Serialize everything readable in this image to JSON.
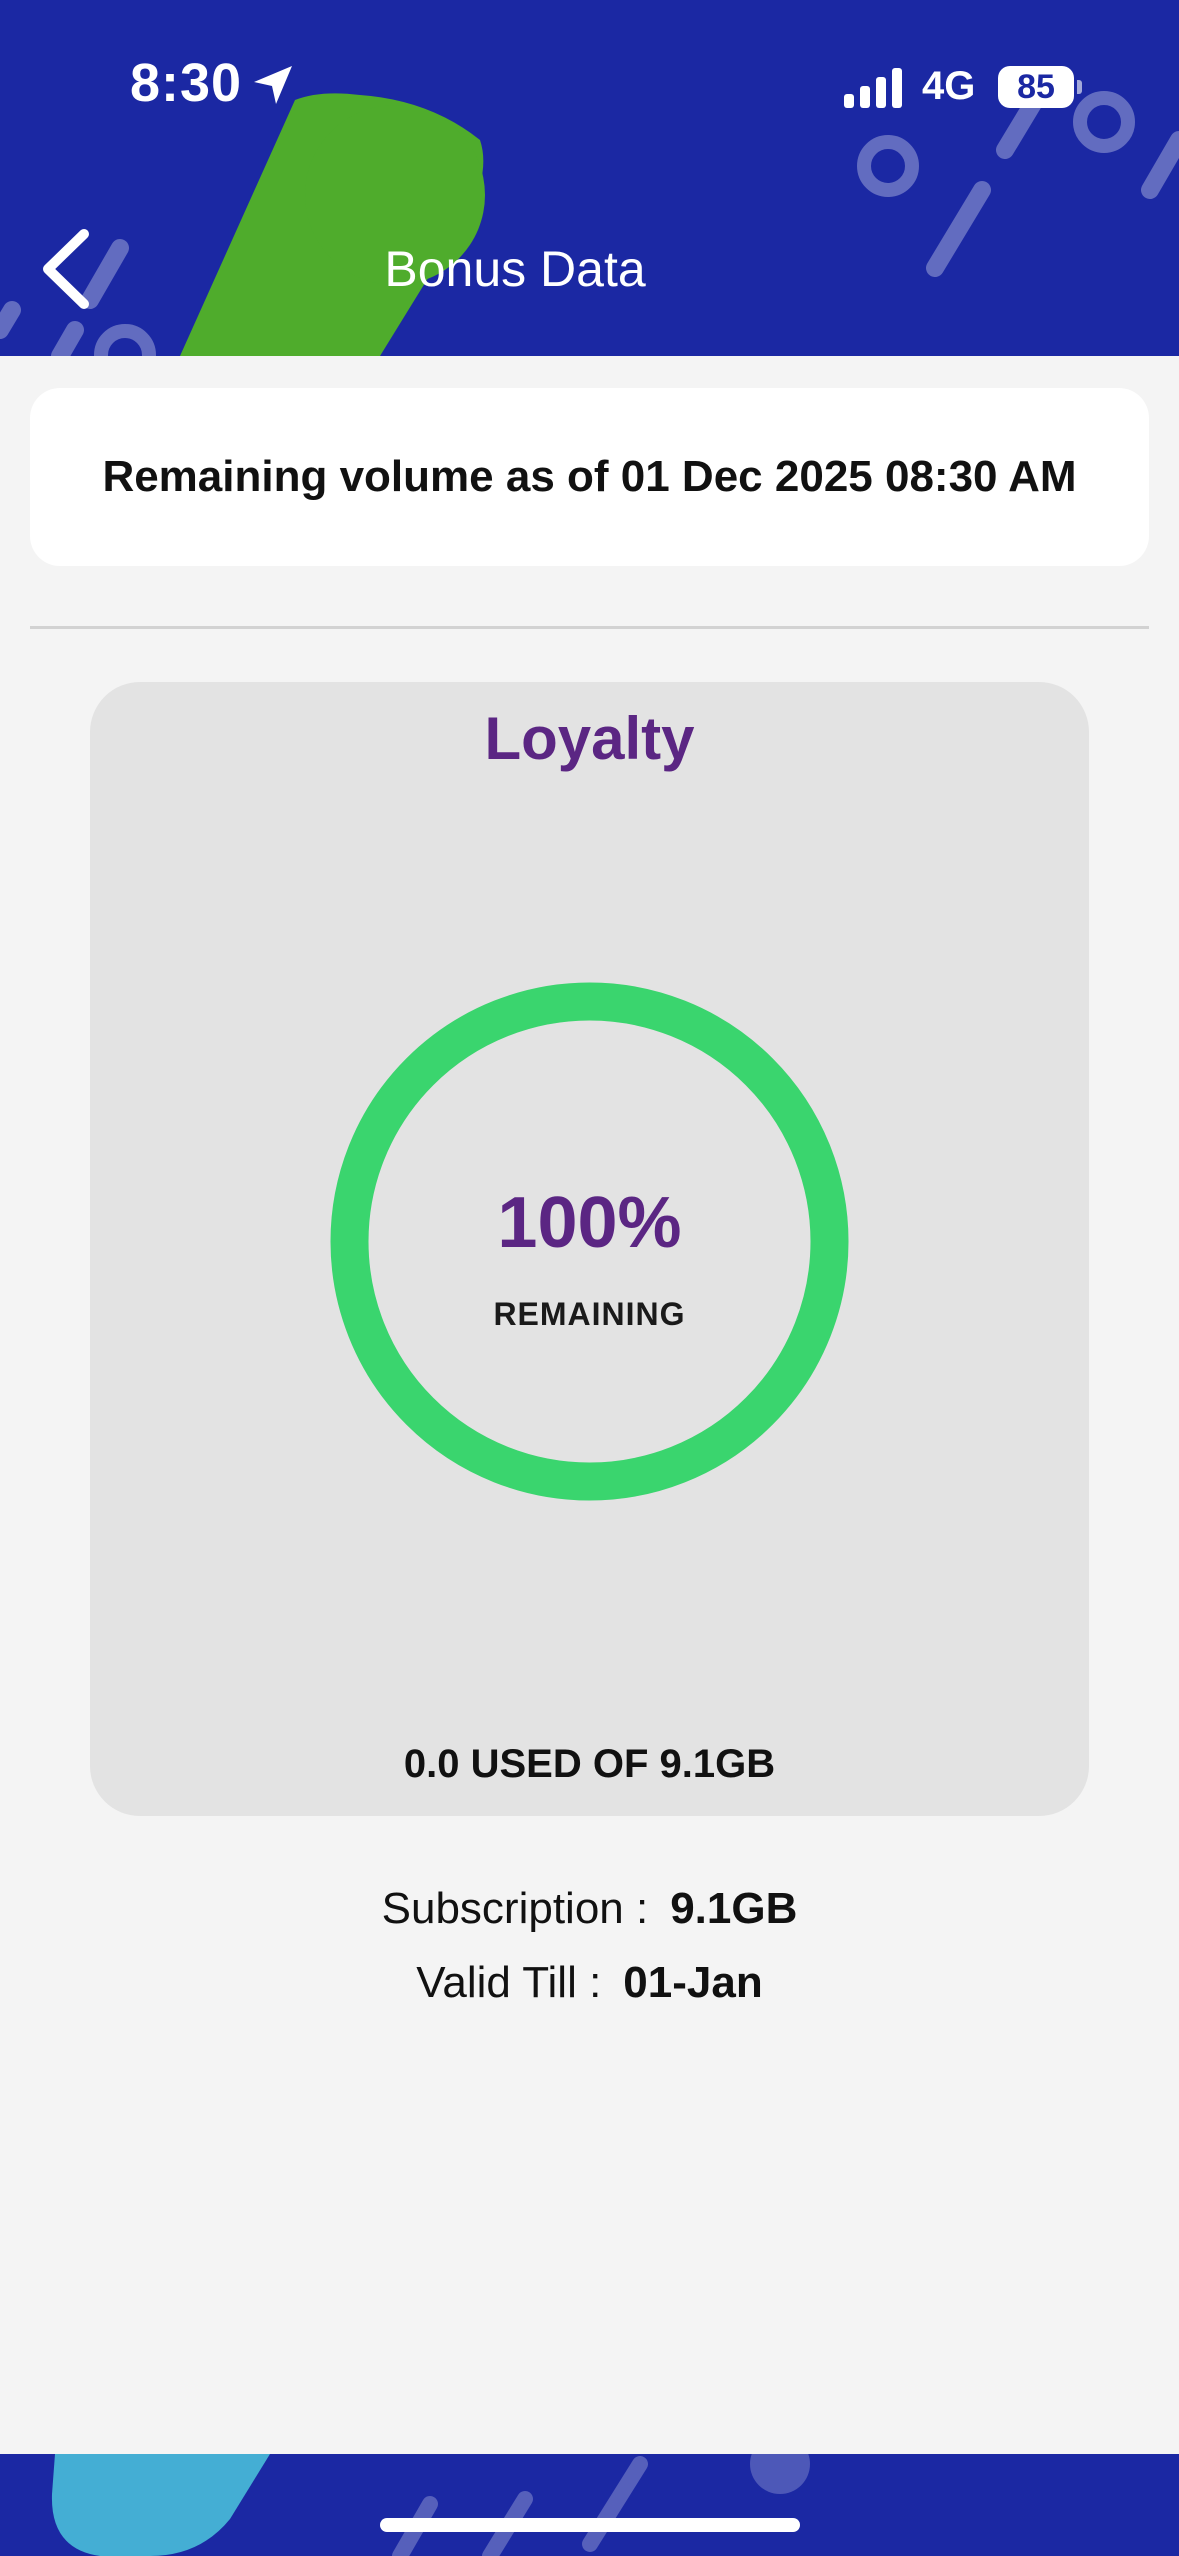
{
  "status_bar": {
    "time": "8:30",
    "network": "4G",
    "battery": "85"
  },
  "header": {
    "title": "Bonus Data"
  },
  "info": {
    "text": "Remaining volume as of 01 Dec 2025 08:30 AM"
  },
  "loyalty_card": {
    "title": "Loyalty",
    "percent_text": "100%",
    "remaining_label": "REMAINING",
    "remaining_fraction": 1.0,
    "usage_text": "0.0 USED OF 9.1GB"
  },
  "details": {
    "subscription_label": "Subscription :",
    "subscription_value": "9.1GB",
    "valid_label": "Valid Till :",
    "valid_value": "01-Jan"
  },
  "colors": {
    "header_blue": "#1b28a3",
    "accent_purple": "#5b2683",
    "ring_green": "#3ad56e",
    "deco_green": "#4fac2c",
    "deco_light_blue": "#44aed4"
  }
}
